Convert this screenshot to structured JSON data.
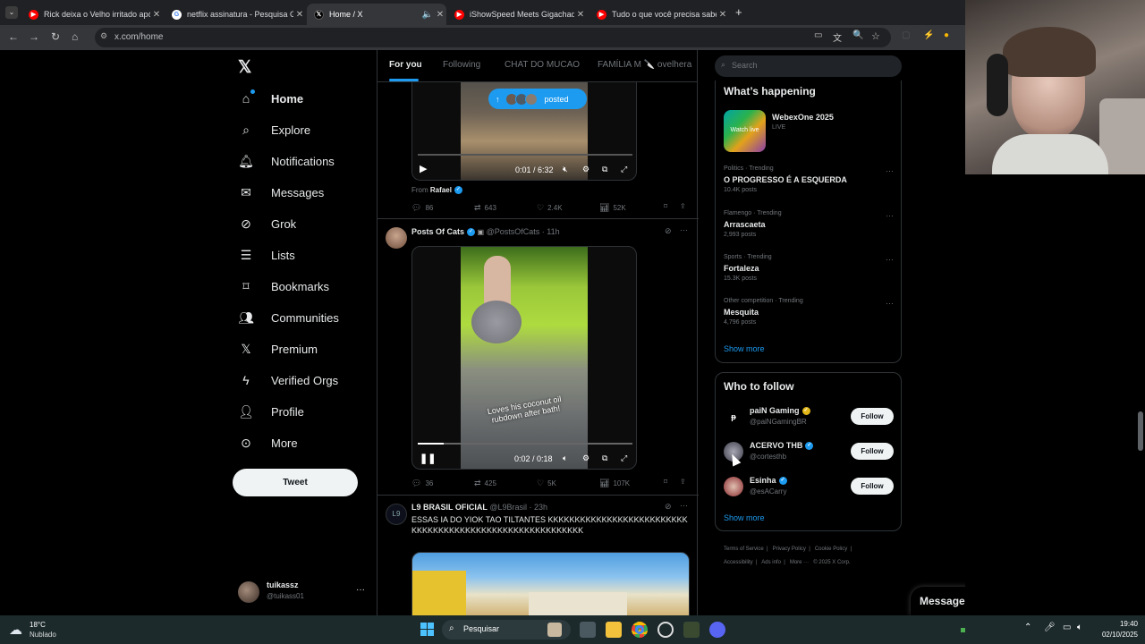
{
  "browser": {
    "tabs": [
      {
        "label": "Rick deixa o Velho irritado após",
        "color": "#ff0000"
      },
      {
        "label": "netflix assinatura - Pesquisa Go",
        "color": "#ffffff"
      },
      {
        "label": "Home / X",
        "color": "#000000"
      },
      {
        "label": "iShowSpeed Meets Gigachad In",
        "color": "#ff0000"
      },
      {
        "label": "Tudo o que você precisa saber",
        "color": "#ff0000"
      }
    ],
    "url": "x.com/home"
  },
  "sidenav": {
    "items": [
      {
        "label": "Home",
        "icon": "home-icon"
      },
      {
        "label": "Explore",
        "icon": "search-icon"
      },
      {
        "label": "Notifications",
        "icon": "bell-icon"
      },
      {
        "label": "Messages",
        "icon": "mail-icon"
      },
      {
        "label": "Grok",
        "icon": "grok-icon"
      },
      {
        "label": "Lists",
        "icon": "list-icon"
      },
      {
        "label": "Bookmarks",
        "icon": "bookmark-icon"
      },
      {
        "label": "Communities",
        "icon": "people-icon"
      },
      {
        "label": "Premium",
        "icon": "x-icon"
      },
      {
        "label": "Verified Orgs",
        "icon": "bolt-icon"
      },
      {
        "label": "Profile",
        "icon": "person-icon"
      },
      {
        "label": "More",
        "icon": "more-icon"
      }
    ],
    "tweet_label": "Tweet",
    "account": {
      "name": "tuikassz",
      "handle": "@tuikass01"
    }
  },
  "feed": {
    "tabs": [
      "For you",
      "Following",
      "CHAT DO MUCAO",
      "FAMÍLIA M 🔪 ovelhera"
    ],
    "posted_pill": "posted",
    "post1": {
      "video_time": "0:01 / 6:32",
      "from_label": "From",
      "from_name": "Rafael",
      "replies": "86",
      "reposts": "643",
      "likes": "2.4K",
      "views": "52K"
    },
    "post2": {
      "author": "Posts Of Cats",
      "handle": "@PostsOfCats",
      "time": "11h",
      "caption": "Loves his coconut oil rubdown after bath!",
      "video_time": "0:02 / 0:18",
      "progress": 0.12,
      "replies": "36",
      "reposts": "425",
      "likes": "5K",
      "views": "107K"
    },
    "post3": {
      "author": "L9 BRASIL OFICIAL",
      "handle": "@L9Brasil",
      "time": "23h",
      "text": "ESSAS IA DO YIOK TAO TILTANTES KKKKKKKKKKKKKKKKKKKKKKKKKKKKKKKKKKKKKKKKKKKKKKKKKKKKKKKKKK"
    }
  },
  "right": {
    "search_placeholder": "Search",
    "happening_title": "What’s happening",
    "live": {
      "title": "WebexOne 2025",
      "status": "LIVE",
      "thumb_text": "Watch live"
    },
    "trends": [
      {
        "meta": "Politics · Trending",
        "name": "O PROGRESSO É A ESQUERDA",
        "count": "10.4K posts"
      },
      {
        "meta": "Flamengo · Trending",
        "name": "Arrascaeta",
        "count": "2,993 posts"
      },
      {
        "meta": "Sports · Trending",
        "name": "Fortaleza",
        "count": "15.3K posts"
      },
      {
        "meta": "Other competition · Trending",
        "name": "Mesquita",
        "count": "4,796 posts"
      }
    ],
    "show_more": "Show more",
    "who_title": "Who to follow",
    "follow": [
      {
        "name": "paiN Gaming",
        "handle": "@paiNGamingBR"
      },
      {
        "name": "ACERVO THB",
        "handle": "@cortesthb"
      },
      {
        "name": "Esinha",
        "handle": "@esACarry"
      }
    ],
    "follow_label": "Follow",
    "footer_line1": [
      "Terms of Service",
      "Privacy Policy",
      "Cookie Policy"
    ],
    "footer_line2": [
      "Accessibility",
      "Ads info",
      "More ···",
      "© 2025 X Corp."
    ],
    "messages_title": "Messages"
  },
  "taskbar": {
    "weather_temp": "18°C",
    "weather_desc": "Nublado",
    "search_label": "Pesquisar",
    "time": "19:40",
    "date": "02/10/2025"
  }
}
